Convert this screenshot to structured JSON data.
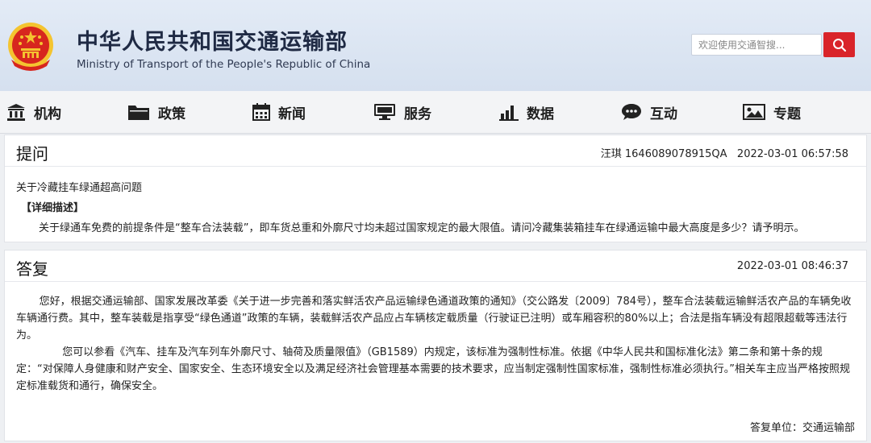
{
  "header": {
    "title_cn": "中华人民共和国交通运输部",
    "title_en": "Ministry of Transport of the People's Republic of China",
    "search_placeholder": "欢迎使用交通智搜...",
    "colors": {
      "search_button": "#d9242a",
      "emblem_red": "#d7261e",
      "emblem_gold": "#f4c430"
    }
  },
  "nav": {
    "items": [
      {
        "label": "机构",
        "icon": "building-icon"
      },
      {
        "label": "政策",
        "icon": "folder-icon"
      },
      {
        "label": "新闻",
        "icon": "calendar-icon"
      },
      {
        "label": "服务",
        "icon": "monitor-icon"
      },
      {
        "label": "数据",
        "icon": "bar-chart-icon"
      },
      {
        "label": "互动",
        "icon": "chat-icon"
      },
      {
        "label": "专题",
        "icon": "image-icon"
      }
    ]
  },
  "question": {
    "heading": "提问",
    "meta": "汪琪 1646089078915QA   2022-03-01 06:57:58",
    "title": "关于冷藏挂车绿通超高问题",
    "detail_label": "【详细描述】",
    "detail": "关于绿通车免费的前提条件是“整车合法装载”，即车货总重和外廓尺寸均未超过国家规定的最大限值。请问冷藏集装箱挂车在绿通运输中最大高度是多少？请予明示。"
  },
  "answer": {
    "heading": "答复",
    "meta": "2022-03-01 08:46:37",
    "paragraph1": "您好，根据交通运输部、国家发展改革委《关于进一步完善和落实鲜活农产品运输绿色通道政策的通知》（交公路发〔2009〕784号），整车合法装载运输鲜活农产品的车辆免收车辆通行费。其中，整车装载是指享受“绿色通道”政策的车辆，装载鲜活农产品应占车辆核定载质量（行驶证已注明）或车厢容积的80%以上；合法是指车辆没有超限超载等违法行为。",
    "paragraph2": "您可以参看《汽车、挂车及汽车列车外廓尺寸、轴荷及质量限值》（GB1589）内规定，该标准为强制性标准。依据《中华人民共和国标准化法》第二条和第十条的规定：“对保障人身健康和财产安全、国家安全、生态环境安全以及满足经济社会管理基本需要的技术要求，应当制定强制性国家标准，强制性标准必须执行。”相关车主应当严格按照规定标准载货和通行，确保安全。",
    "signature": "答复单位：交通运输部"
  }
}
